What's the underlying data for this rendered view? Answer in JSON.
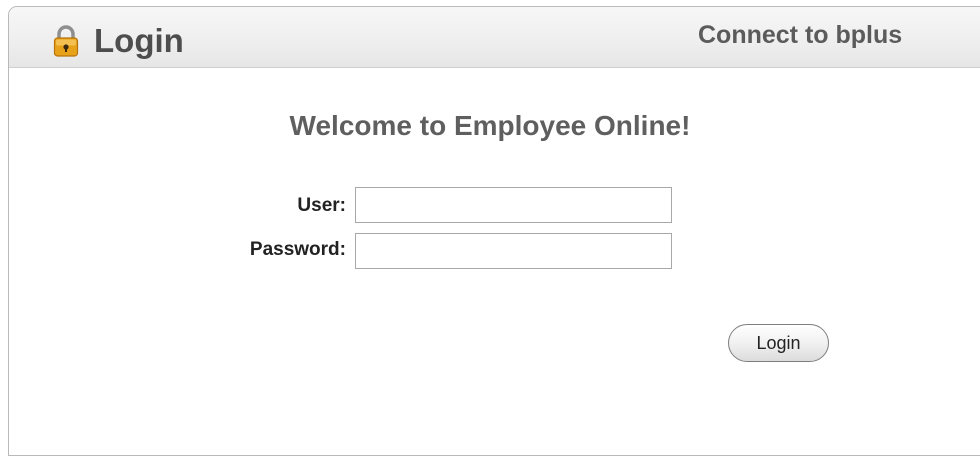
{
  "header": {
    "title": "Login",
    "connect_text": "Connect to bplus",
    "lock_icon": "padlock-icon"
  },
  "main": {
    "welcome": "Welcome to Employee Online!",
    "user_label": "User:",
    "user_value": "",
    "password_label": "Password:",
    "password_value": "",
    "login_button": "Login"
  },
  "colors": {
    "lock_body": "#e8a21a",
    "lock_shackle": "#8a8a8a",
    "title_text": "#4d4d4d"
  }
}
